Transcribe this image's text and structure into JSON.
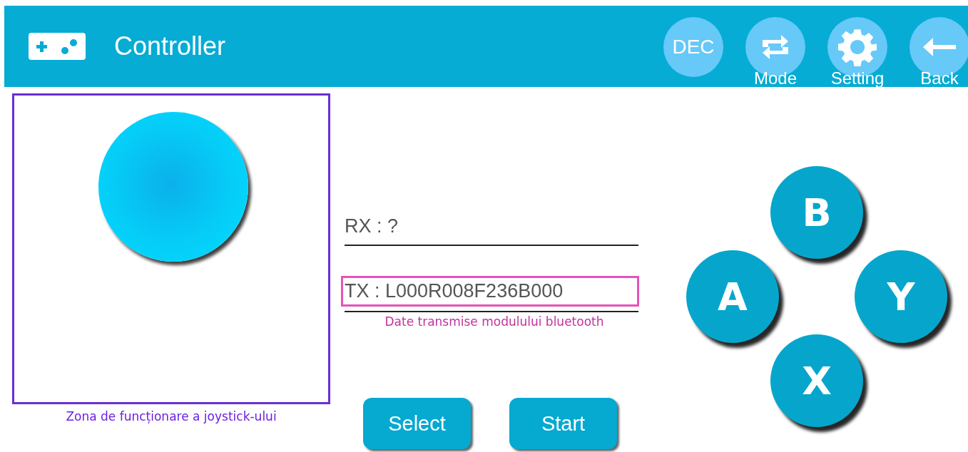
{
  "header": {
    "title": "Controller",
    "actions": [
      {
        "kind": "text",
        "label": "DEC"
      },
      {
        "kind": "swap",
        "label": "Mode"
      },
      {
        "kind": "gear",
        "label": "Setting"
      },
      {
        "kind": "back",
        "label": "Back"
      }
    ]
  },
  "joystick": {
    "caption": "Zona de funcționare a joystick-ului"
  },
  "rx": {
    "value": "RX : ?"
  },
  "tx": {
    "value": "TX : L000R008F236B000",
    "highlighted": true,
    "caption": "Date transmise modulului bluetooth"
  },
  "bottom_buttons": [
    "Select",
    "Start"
  ],
  "face_buttons": [
    "B",
    "A",
    "Y",
    "X"
  ]
}
